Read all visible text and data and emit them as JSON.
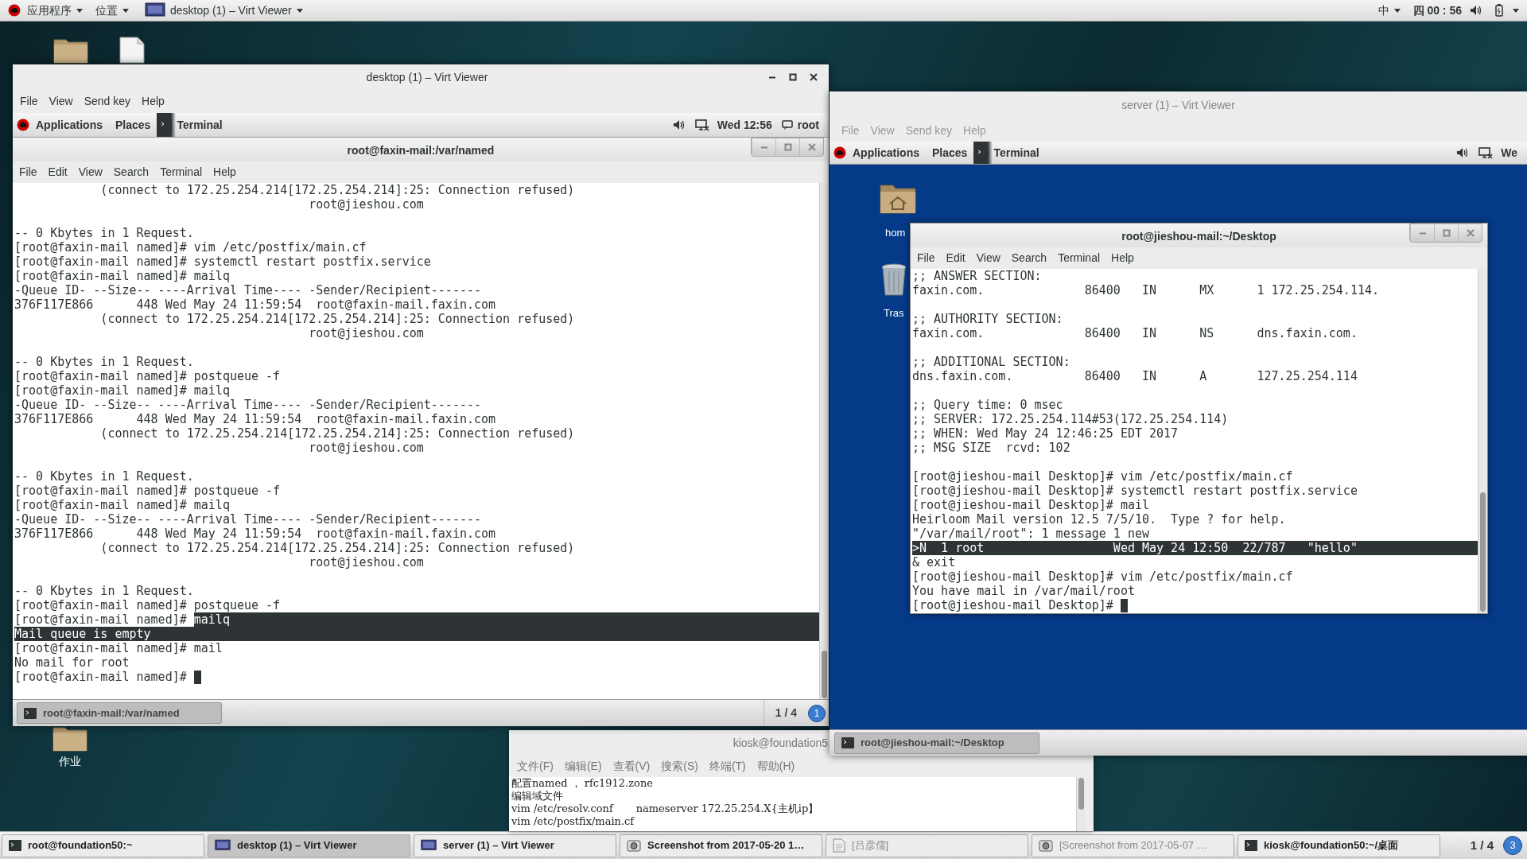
{
  "top_bar": {
    "menus": [
      {
        "label": "应用程序"
      },
      {
        "label": "位置"
      }
    ],
    "active_window": "desktop (1) – Virt Viewer",
    "input_method": "中",
    "clock": "四 00 : 56"
  },
  "desktop_icons": [
    {
      "kind": "folder"
    },
    {
      "kind": "file"
    },
    {
      "kind": "folder",
      "label": "作业"
    }
  ],
  "desktop_viewer": {
    "title": "desktop (1) – Virt Viewer",
    "menu": [
      "File",
      "View",
      "Send key",
      "Help"
    ],
    "guest_panel": {
      "menus": [
        "Applications",
        "Places"
      ],
      "task": "Terminal",
      "clock": "Wed 12:56",
      "user": "root"
    },
    "terminal": {
      "title": "root@faxin-mail:/var/named",
      "menu": [
        "File",
        "Edit",
        "View",
        "Search",
        "Terminal",
        "Help"
      ],
      "lines": [
        {
          "text": "            (connect to 172.25.254.214[172.25.254.214]:25: Connection refused)",
          "selected": false,
          "cursor": false
        },
        {
          "text": "                                         root@jieshou.com",
          "selected": false,
          "cursor": false
        },
        {
          "selected": false,
          "cursor": false
        },
        {
          "text": "-- 0 Kbytes in 1 Request.",
          "selected": false,
          "cursor": false
        },
        {
          "text": "[root@faxin-mail named]# vim /etc/postfix/main.cf",
          "selected": false,
          "cursor": false
        },
        {
          "text": "[root@faxin-mail named]# systemctl restart postfix.service",
          "selected": false,
          "cursor": false
        },
        {
          "text": "[root@faxin-mail named]# mailq",
          "selected": false,
          "cursor": false
        },
        {
          "text": "-Queue ID- --Size-- ----Arrival Time---- -Sender/Recipient-------",
          "selected": false,
          "cursor": false
        },
        {
          "text": "376F117E866      448 Wed May 24 11:59:54  root@faxin-mail.faxin.com",
          "selected": false,
          "cursor": false
        },
        {
          "text": "            (connect to 172.25.254.214[172.25.254.214]:25: Connection refused)",
          "selected": false,
          "cursor": false
        },
        {
          "text": "                                         root@jieshou.com",
          "selected": false,
          "cursor": false
        },
        {
          "selected": false,
          "cursor": false
        },
        {
          "text": "-- 0 Kbytes in 1 Request.",
          "selected": false,
          "cursor": false
        },
        {
          "text": "[root@faxin-mail named]# postqueue -f",
          "selected": false,
          "cursor": false
        },
        {
          "text": "[root@faxin-mail named]# mailq",
          "selected": false,
          "cursor": false
        },
        {
          "text": "-Queue ID- --Size-- ----Arrival Time---- -Sender/Recipient-------",
          "selected": false,
          "cursor": false
        },
        {
          "text": "376F117E866      448 Wed May 24 11:59:54  root@faxin-mail.faxin.com",
          "selected": false,
          "cursor": false
        },
        {
          "text": "            (connect to 172.25.254.214[172.25.254.214]:25: Connection refused)",
          "selected": false,
          "cursor": false
        },
        {
          "text": "                                         root@jieshou.com",
          "selected": false,
          "cursor": false
        },
        {
          "selected": false,
          "cursor": false
        },
        {
          "text": "-- 0 Kbytes in 1 Request.",
          "selected": false,
          "cursor": false
        },
        {
          "text": "[root@faxin-mail named]# postqueue -f",
          "selected": false,
          "cursor": false
        },
        {
          "text": "[root@faxin-mail named]# mailq",
          "selected": false,
          "cursor": false
        },
        {
          "text": "-Queue ID- --Size-- ----Arrival Time---- -Sender/Recipient-------",
          "selected": false,
          "cursor": false
        },
        {
          "text": "376F117E866      448 Wed May 24 11:59:54  root@faxin-mail.faxin.com",
          "selected": false,
          "cursor": false
        },
        {
          "text": "            (connect to 172.25.254.214[172.25.254.214]:25: Connection refused)",
          "selected": false,
          "cursor": false
        },
        {
          "text": "                                         root@jieshou.com",
          "selected": false,
          "cursor": false
        },
        {
          "selected": false,
          "cursor": false
        },
        {
          "text": "-- 0 Kbytes in 1 Request.",
          "selected": false,
          "cursor": false
        },
        {
          "text": "[root@faxin-mail named]# postqueue -f",
          "selected": false,
          "cursor": false
        },
        {
          "text": "[root@faxin-mail named]# ",
          "selected_text": "mailq",
          "selected": true,
          "cursor": false
        },
        {
          "text": "Mail queue is empty",
          "selected": true,
          "cursor": false
        },
        {
          "text": "[root@faxin-mail named]# mail",
          "selected": false,
          "cursor": false
        },
        {
          "text": "No mail for root",
          "selected": false,
          "cursor": false
        },
        {
          "text": "[root@faxin-mail named]# ",
          "selected": false,
          "cursor": true
        }
      ]
    },
    "guest_taskbar": {
      "task": "root@faxin-mail:/var/named",
      "pager": "1 / 4",
      "workspace": "1"
    }
  },
  "server_viewer": {
    "title": "server (1) – Virt Viewer",
    "menu": [
      "File",
      "View",
      "Send key",
      "Help"
    ],
    "guest_panel": {
      "menus": [
        "Applications",
        "Places"
      ],
      "task": "Terminal",
      "clock": "We"
    },
    "desktop_icons": [
      {
        "kind": "home",
        "label": "hom"
      },
      {
        "kind": "trash",
        "label": "Tras"
      }
    ],
    "terminal": {
      "title": "root@jieshou-mail:~/Desktop",
      "menu": [
        "File",
        "Edit",
        "View",
        "Search",
        "Terminal",
        "Help"
      ],
      "lines": [
        {
          "text": ";; ANSWER SECTION:",
          "selected": false,
          "cursor": false
        },
        {
          "text": "faxin.com.\t\t86400\tIN\tMX\t1 172.25.254.114.",
          "selected": false,
          "cursor": false
        },
        {
          "selected": false,
          "cursor": false
        },
        {
          "text": ";; AUTHORITY SECTION:",
          "selected": false,
          "cursor": false
        },
        {
          "text": "faxin.com.\t\t86400\tIN\tNS\tdns.faxin.com.",
          "selected": false,
          "cursor": false
        },
        {
          "selected": false,
          "cursor": false
        },
        {
          "text": ";; ADDITIONAL SECTION:",
          "selected": false,
          "cursor": false
        },
        {
          "text": "dns.faxin.com.\t\t86400\tIN\tA\t127.25.254.114",
          "selected": false,
          "cursor": false
        },
        {
          "selected": false,
          "cursor": false
        },
        {
          "text": ";; Query time: 0 msec",
          "selected": false,
          "cursor": false
        },
        {
          "text": ";; SERVER: 172.25.254.114#53(172.25.254.114)",
          "selected": false,
          "cursor": false
        },
        {
          "text": ";; WHEN: Wed May 24 12:46:25 EDT 2017",
          "selected": false,
          "cursor": false
        },
        {
          "text": ";; MSG SIZE  rcvd: 102",
          "selected": false,
          "cursor": false
        },
        {
          "selected": false,
          "cursor": false
        },
        {
          "text": "[root@jieshou-mail Desktop]# vim /etc/postfix/main.cf",
          "selected": false,
          "cursor": false
        },
        {
          "text": "[root@jieshou-mail Desktop]# systemctl restart postfix.service",
          "selected": false,
          "cursor": false
        },
        {
          "text": "[root@jieshou-mail Desktop]# mail",
          "selected": false,
          "cursor": false
        },
        {
          "text": "Heirloom Mail version 12.5 7/5/10.  Type ? for help.",
          "selected": false,
          "cursor": false
        },
        {
          "text": "\"/var/mail/root\": 1 message 1 new",
          "selected": false,
          "cursor": false
        },
        {
          "text": ">N  1 root                  Wed May 24 12:50  22/787   \"hello\"",
          "selected": true,
          "cursor": false
        },
        {
          "text": "& exit",
          "selected": false,
          "cursor": false
        },
        {
          "text": "[root@jieshou-mail Desktop]# vim /etc/postfix/main.cf",
          "selected": false,
          "cursor": false
        },
        {
          "text": "You have mail in /var/mail/root",
          "selected": false,
          "cursor": false
        },
        {
          "text": "[root@jieshou-mail Desktop]# ",
          "selected": false,
          "cursor": true
        }
      ]
    },
    "guest_taskbar": {
      "task": "root@jieshou-mail:~/Desktop"
    }
  },
  "kiosk_terminal": {
    "title": "kiosk@foundation5",
    "menu": [
      "文件(F)",
      "编辑(E)",
      "查看(V)",
      "搜索(S)",
      "终端(T)",
      "帮助(H)"
    ],
    "lines": [
      "配置named ， rfc1912.zone",
      "编辑域文件",
      "vim /etc/resolv.conf       nameserver 172.25.254.X{主机ip】",
      "vim /etc/postfix/main.cf"
    ]
  },
  "taskbar": {
    "items": [
      {
        "kind": "terminal",
        "label": "root@foundation50:~",
        "selected": false,
        "minimized": false
      },
      {
        "kind": "viewer",
        "label": "desktop (1) – Virt Viewer",
        "selected": true,
        "minimized": false
      },
      {
        "kind": "viewer",
        "label": "server (1) – Virt Viewer",
        "selected": false,
        "minimized": false
      },
      {
        "kind": "image",
        "label": "Screenshot from 2017-05-20 1…",
        "selected": false,
        "minimized": false
      },
      {
        "kind": "document",
        "label": "[吕彦儒]",
        "selected": false,
        "minimized": true
      },
      {
        "kind": "image",
        "label": "[Screenshot from 2017-05-07 …",
        "selected": false,
        "minimized": true
      },
      {
        "kind": "terminal",
        "label": "kiosk@foundation50:~/桌面",
        "selected": false,
        "minimized": false
      }
    ],
    "pager": "1 / 4",
    "workspace": "3"
  }
}
